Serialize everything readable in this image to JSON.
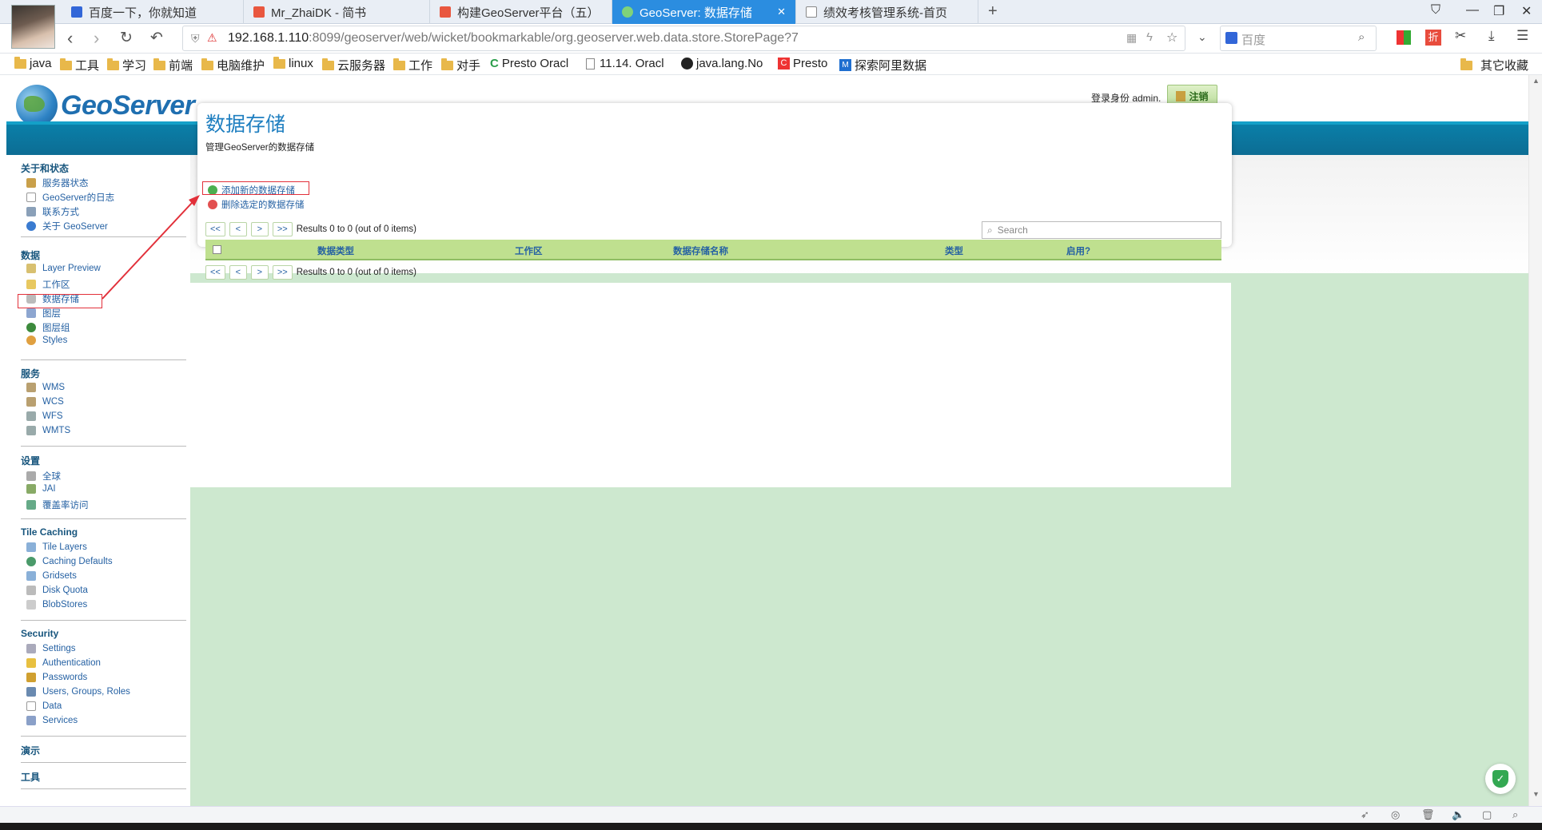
{
  "browser": {
    "tabs": [
      {
        "label": "百度一下，你就知道",
        "active": false,
        "icon": "baidu-paw-icon"
      },
      {
        "label": "Mr_ZhaiDK - 简书",
        "active": false,
        "icon": "jianshu-icon"
      },
      {
        "label": "构建GeoServer平台（五）",
        "active": false,
        "icon": "jianshu-icon"
      },
      {
        "label": "GeoServer: 数据存储",
        "active": true,
        "icon": "geoserver-icon"
      },
      {
        "label": "绩效考核管理系统-首页",
        "active": false,
        "icon": "page-icon"
      }
    ],
    "url_host": "192.168.1.110",
    "url_rest": ":8099/geoserver/web/wicket/bookmarkable/org.geoserver.web.data.store.StorePage?7",
    "search_engine": "百度",
    "bookmarks": [
      {
        "label": "java",
        "type": "folder"
      },
      {
        "label": "工具",
        "type": "folder"
      },
      {
        "label": "学习",
        "type": "folder"
      },
      {
        "label": "前端",
        "type": "folder"
      },
      {
        "label": "电脑维护",
        "type": "folder"
      },
      {
        "label": "linux",
        "type": "folder"
      },
      {
        "label": "云服务器",
        "type": "folder"
      },
      {
        "label": "工作",
        "type": "folder"
      },
      {
        "label": "对手",
        "type": "folder"
      },
      {
        "label": "Presto Oracl",
        "type": "link"
      },
      {
        "label": "11.14. Oracl",
        "type": "link"
      },
      {
        "label": "java.lang.No",
        "type": "link"
      },
      {
        "label": "Presto",
        "type": "link"
      },
      {
        "label": "探索阿里数据",
        "type": "link"
      }
    ],
    "other_bookmarks": "其它收藏"
  },
  "header": {
    "logo_text": "GeoServer",
    "login_text": "登录身份 admin.",
    "logout_label": "注销"
  },
  "sidebar": {
    "groups": [
      {
        "title": "关于和状态",
        "items": [
          "服务器状态",
          "GeoServer的日志",
          "联系方式",
          "关于 GeoServer"
        ]
      },
      {
        "title": "数据",
        "items": [
          "Layer Preview",
          "工作区",
          "数据存储",
          "图层",
          "图层组",
          "Styles"
        ]
      },
      {
        "title": "服务",
        "items": [
          "WMS",
          "WCS",
          "WFS",
          "WMTS"
        ]
      },
      {
        "title": "设置",
        "items": [
          "全球",
          "JAI",
          "覆盖率访问"
        ]
      },
      {
        "title": "Tile Caching",
        "items": [
          "Tile Layers",
          "Caching Defaults",
          "Gridsets",
          "Disk Quota",
          "BlobStores"
        ]
      },
      {
        "title": "Security",
        "items": [
          "Settings",
          "Authentication",
          "Passwords",
          "Users, Groups, Roles",
          "Data",
          "Services"
        ]
      },
      {
        "title": "演示",
        "items": []
      },
      {
        "title": "工具",
        "items": []
      }
    ]
  },
  "main": {
    "title": "数据存储",
    "description": "管理GeoServer的数据存储",
    "add_label": "添加新的数据存储",
    "remove_label": "删除选定的数据存储",
    "pager": {
      "first": "<<",
      "prev": "<",
      "next": ">",
      "last": ">>",
      "results": "Results 0 to 0 (out of 0 items)"
    },
    "search_placeholder": "Search",
    "columns": [
      "数据类型",
      "工作区",
      "数据存储名称",
      "类型",
      "启用?"
    ]
  },
  "colors": {
    "accent": "#2b8de0",
    "header_bar": "#0d6d94",
    "table_header": "#bfe08f",
    "page_bg": "#cde8cf",
    "annotation": "#e2303a"
  }
}
